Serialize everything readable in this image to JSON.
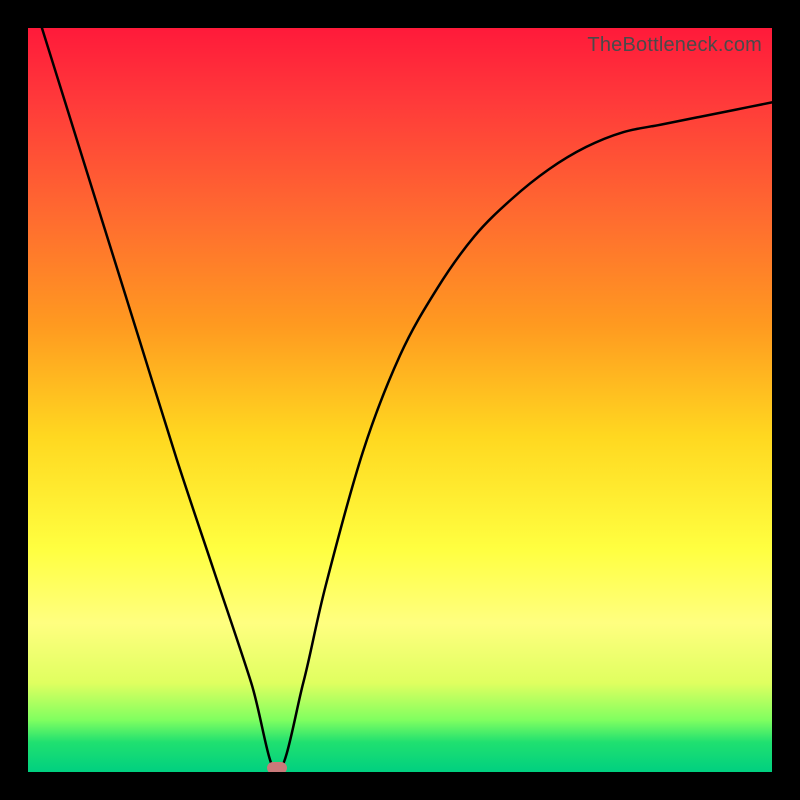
{
  "watermark": "TheBottleneck.com",
  "chart_data": {
    "type": "line",
    "title": "",
    "xlabel": "",
    "ylabel": "",
    "xlim": [
      0,
      1
    ],
    "ylim": [
      0,
      1
    ],
    "x": [
      0.0,
      0.05,
      0.1,
      0.15,
      0.2,
      0.25,
      0.3,
      0.335,
      0.37,
      0.4,
      0.45,
      0.5,
      0.55,
      0.6,
      0.65,
      0.7,
      0.75,
      0.8,
      0.85,
      0.9,
      0.95,
      1.0
    ],
    "y": [
      1.06,
      0.9,
      0.74,
      0.58,
      0.42,
      0.27,
      0.12,
      0.0,
      0.12,
      0.25,
      0.43,
      0.56,
      0.65,
      0.72,
      0.77,
      0.81,
      0.84,
      0.86,
      0.87,
      0.88,
      0.89,
      0.9
    ],
    "marker": {
      "x": 0.335,
      "y": 0.006
    },
    "line_color": "#000000",
    "line_width": 2.5
  },
  "colors": {
    "background": "#000000",
    "gradient_top": "#ff1a3a",
    "gradient_bottom": "#00d080",
    "marker": "#c97a7a"
  }
}
